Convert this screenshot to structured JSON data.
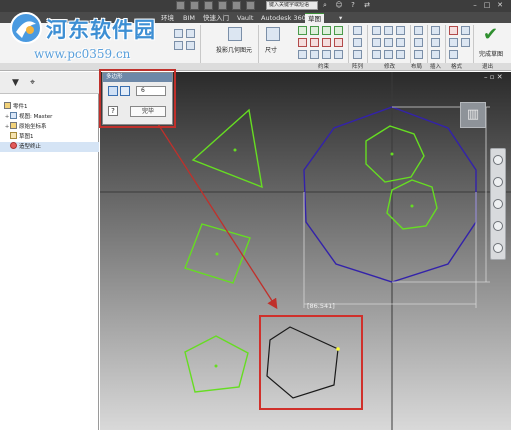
{
  "titlebar": {
    "search_placeholder": "键入关键字或短语"
  },
  "ribbon": {
    "tabs": [
      {
        "label": "环境"
      },
      {
        "label": "BIM"
      },
      {
        "label": "快速入门"
      },
      {
        "label": "Vault"
      },
      {
        "label": "Autodesk 360"
      },
      {
        "label": "草图",
        "active": true
      }
    ],
    "left_labels": {
      "project_geometry": "投影几何图元",
      "dimension": "尺寸"
    },
    "panels": {
      "constrain": "约束",
      "pattern": "阵列",
      "modify": "修改",
      "layout": "布局",
      "insert": "插入",
      "format": "格式",
      "exit": "退出"
    },
    "finish_sketch": "完成草图"
  },
  "watermark": {
    "site_name": "河东软件园",
    "url": "www.pc0359.cn"
  },
  "browser": {
    "items": [
      {
        "label": "零件1",
        "indent": 0,
        "icon": "part"
      },
      {
        "label": "视图: Master",
        "indent": 1,
        "icon": "glass"
      },
      {
        "label": "原始坐标系",
        "indent": 1,
        "icon": "part"
      },
      {
        "label": "草图1",
        "indent": 1,
        "icon": "sketch"
      },
      {
        "label": "造型终止",
        "indent": 1,
        "icon": "end"
      }
    ]
  },
  "mini_toolbar": {
    "title": "多边形",
    "sides_value": "6",
    "done_label": "完毕",
    "help_label": "?"
  },
  "canvas": {
    "dimension_text": "[86.541]",
    "shape_color": "#66dd22",
    "outer_polygon_color": "#3322aa",
    "new_hexagon_color": "#1a1a1a",
    "highlight_color": "#d0302b"
  }
}
